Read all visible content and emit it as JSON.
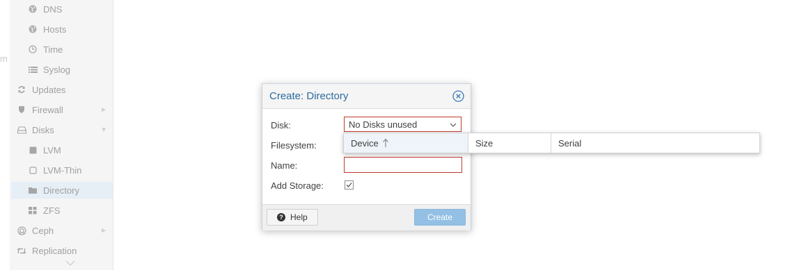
{
  "sidebar": {
    "cut_text": "m",
    "items": [
      {
        "label": "DNS",
        "icon": "globe-icon"
      },
      {
        "label": "Hosts",
        "icon": "globe-icon"
      },
      {
        "label": "Time",
        "icon": "clock-icon"
      },
      {
        "label": "Syslog",
        "icon": "list-icon"
      },
      {
        "label": "Updates",
        "icon": "refresh-icon"
      },
      {
        "label": "Firewall",
        "icon": "shield-icon"
      },
      {
        "label": "Disks",
        "icon": "hdd-icon"
      },
      {
        "label": "LVM",
        "icon": "square-icon"
      },
      {
        "label": "LVM-Thin",
        "icon": "square-outline-icon"
      },
      {
        "label": "Directory",
        "icon": "folder-icon"
      },
      {
        "label": "ZFS",
        "icon": "grid-icon"
      },
      {
        "label": "Ceph",
        "icon": "ceph-icon"
      },
      {
        "label": "Replication",
        "icon": "retweet-icon"
      }
    ]
  },
  "dialog": {
    "title": "Create: Directory",
    "fields": {
      "disk_label": "Disk:",
      "disk_value": "No Disks unused",
      "filesystem_label": "Filesystem:",
      "name_label": "Name:",
      "name_value": "",
      "add_storage_label": "Add Storage:",
      "add_storage_checked": true
    },
    "help_label": "Help",
    "create_label": "Create",
    "colors": {
      "title": "#2b6b9e",
      "invalid_border": "#c0392b",
      "create_button": "#93c0e4"
    }
  },
  "disk_grid": {
    "columns": [
      "Device",
      "Size",
      "Serial"
    ],
    "sorted_column": "Device",
    "sort_direction": "ascending",
    "rows": []
  }
}
